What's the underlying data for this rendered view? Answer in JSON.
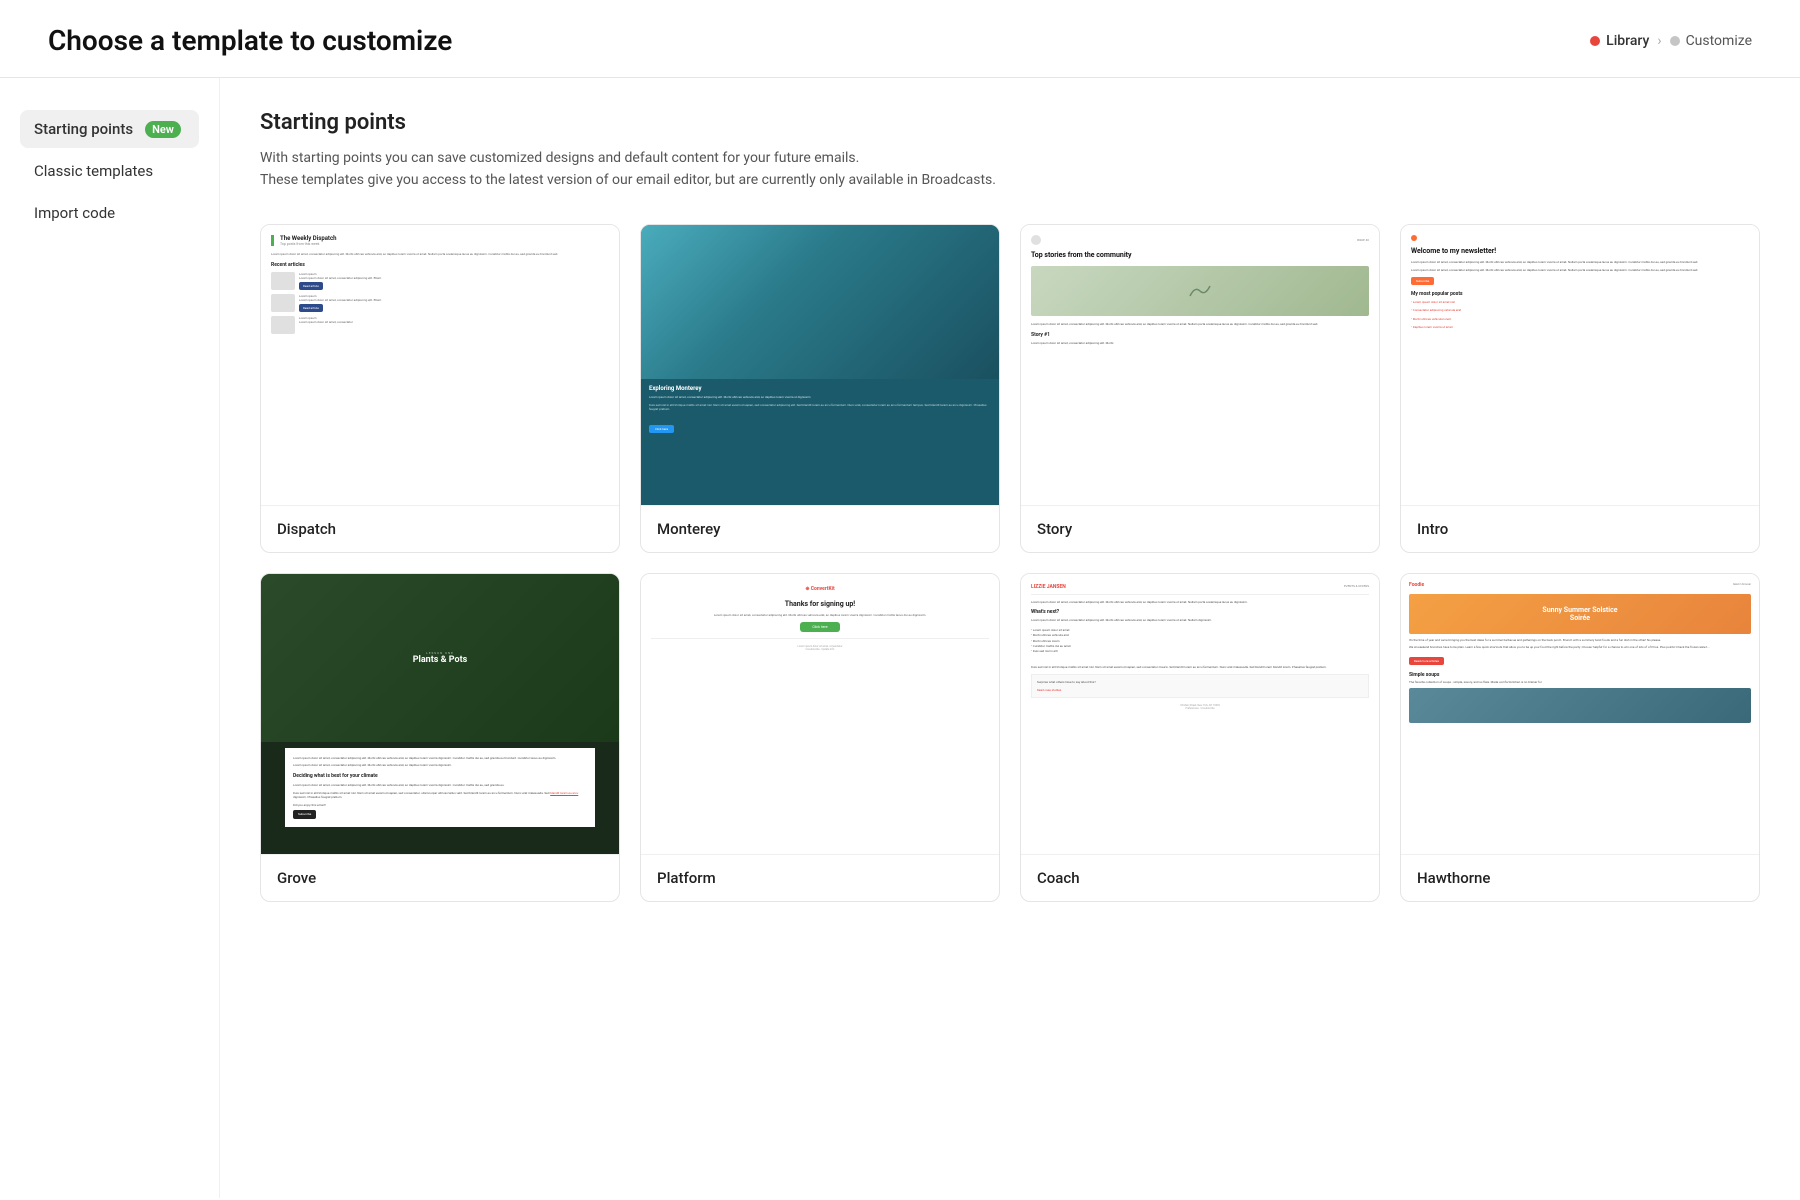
{
  "header": {
    "title": "Choose a template to customize",
    "breadcrumb": {
      "library": "Library",
      "customize": "Customize"
    }
  },
  "sidebar": {
    "items": [
      {
        "id": "starting-points",
        "label": "Starting points",
        "badge": "New",
        "active": true
      },
      {
        "id": "classic-templates",
        "label": "Classic templates",
        "active": false
      },
      {
        "id": "import-code",
        "label": "Import code",
        "active": false
      }
    ]
  },
  "content": {
    "title": "Starting points",
    "description_line1": "With starting points you can save customized designs and default content for your future emails.",
    "description_line2": "These templates give you access to the latest version of our email editor, but are currently only available in Broadcasts.",
    "templates": [
      {
        "id": "dispatch",
        "name": "Dispatch"
      },
      {
        "id": "monterey",
        "name": "Monterey"
      },
      {
        "id": "story",
        "name": "Story"
      },
      {
        "id": "intro",
        "name": "Intro"
      },
      {
        "id": "grove",
        "name": "Grove"
      },
      {
        "id": "platform",
        "name": "Platform"
      },
      {
        "id": "coach",
        "name": "Coach"
      },
      {
        "id": "hawthorne",
        "name": "Hawthorne"
      }
    ]
  }
}
